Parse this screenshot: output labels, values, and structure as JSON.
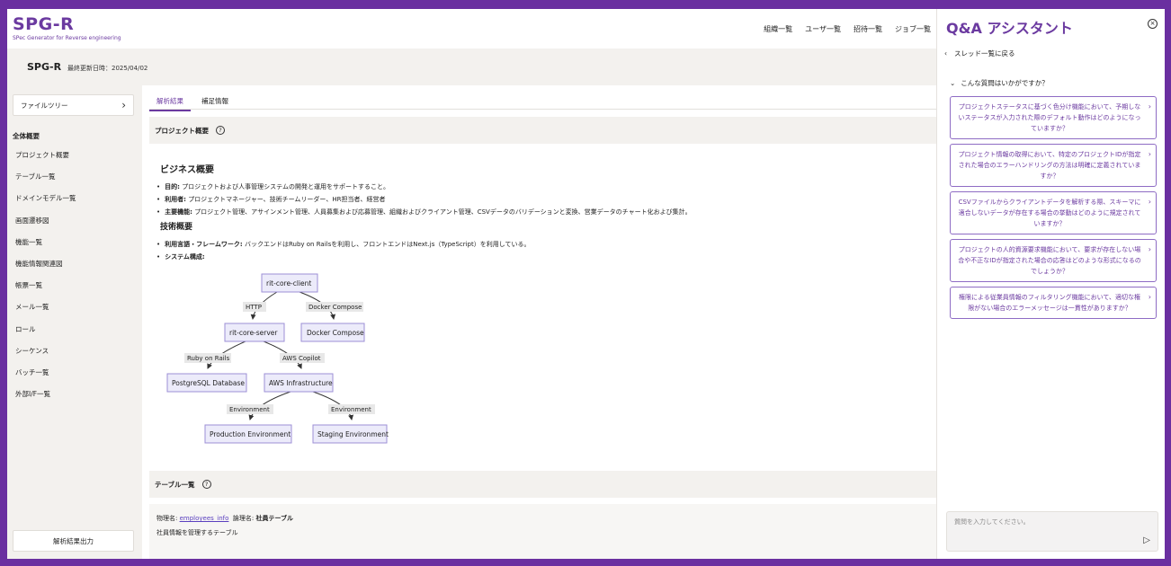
{
  "app": {
    "logo": "SPG-R",
    "logo_sub": "SPec Generator for Reverse engineering"
  },
  "nav": {
    "items": [
      "組織一覧",
      "ユーザ一覧",
      "招待一覧",
      "ジョブ一覧"
    ]
  },
  "project": {
    "name": "SPG-R",
    "updated": "最終更新日時：2025/04/02"
  },
  "sidebar": {
    "tree_button": "ファイルツリー",
    "section": "全体概要",
    "items": [
      "プロジェクト概要",
      "テーブル一覧",
      "ドメインモデル一覧",
      "画面遷移図",
      "機能一覧",
      "機能情報関連図",
      "帳票一覧",
      "メール一覧",
      "ロール",
      "シーケンス",
      "バッチ一覧",
      "外部I/F一覧"
    ],
    "export_button": "解析結果出力"
  },
  "main": {
    "tabs": [
      "解析結果",
      "補足情報"
    ],
    "project_section": "プロジェクト概要",
    "business_heading": "ビジネス概要",
    "business": [
      {
        "label": "目的:",
        "text": "プロジェクトおよび人事管理システムの開発と運用をサポートすること。"
      },
      {
        "label": "利用者:",
        "text": "プロジェクトマネージャー、技術チームリーダー、HR担当者、経営者"
      },
      {
        "label": "主要機能:",
        "text": "プロジェクト管理、アサインメント管理、人員募集および応募管理、組織およびクライアント管理、CSVデータのバリデーションと変換、営業データのチャート化および集計。"
      }
    ],
    "tech_heading": "技術概要",
    "tech": [
      {
        "label": "利用言語・フレームワーク:",
        "text": "バックエンドはRuby on Railsを利用し、フロントエンドはNext.js（TypeScript）を利用している。"
      },
      {
        "label": "システム構成:",
        "text": ""
      }
    ],
    "diagram": {
      "nodes": [
        "rit-core-client",
        "rit-core-server",
        "Docker Compose",
        "PostgreSQL Database",
        "AWS Infrastructure",
        "Production Environment",
        "Staging Environment"
      ],
      "edges": [
        "HTTP",
        "Docker Compose",
        "Ruby on Rails",
        "AWS Copilot",
        "Environment",
        "Environment"
      ]
    },
    "table_section": "テーブル一覧",
    "table": {
      "physical_label": "物理名:",
      "physical_name": "employees_info",
      "logical_label": "論理名:",
      "logical_name": "社員テーブル",
      "description": "社員情報を管理するテーブル"
    }
  },
  "qa": {
    "title": "Q&A アシスタント",
    "back": "スレッド一覧に戻る",
    "suggest_heading": "こんな質問はいかがですか？",
    "suggestions": [
      "プロジェクトステータスに基づく色分け機能において、予期しないステータスが入力された際のデフォルト動作はどのようになっていますか？",
      "プロジェクト情報の取得において、特定のプロジェクトIDが指定された場合のエラーハンドリングの方法は明確に定義されていますか？",
      "CSVファイルからクライアントデータを解析する際、スキーマに適合しないデータが存在する場合の挙動はどのように規定されていますか？",
      "プロジェクトの人的資源要求機能において、要求が存在しない場合や不正なIDが指定された場合の応答はどのような形式になるのでしょうか？",
      "権限による従業員情報のフィルタリング機能において、適切な権限がない場合のエラーメッセージは一貫性がありますか？"
    ],
    "input_placeholder": "質問を入力してください。"
  },
  "colors": {
    "accent": "#6b3aa0",
    "frame": "#6a2fa0",
    "node_fill": "#ecebfa",
    "node_stroke": "#9c8fd6"
  }
}
